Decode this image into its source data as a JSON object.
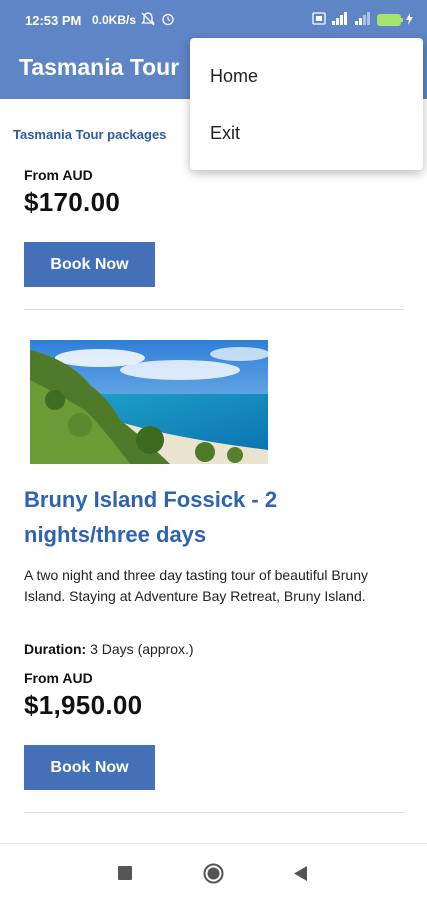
{
  "status_bar": {
    "time": "12:53 PM",
    "speed": "0.0KB/s",
    "battery": "100"
  },
  "app_bar": {
    "title": "Tasmania Tour"
  },
  "breadcrumb": "Tasmania Tour packages",
  "menu": {
    "items": [
      {
        "label": "Home"
      },
      {
        "label": "Exit"
      }
    ]
  },
  "tours": [
    {
      "from_label": "From AUD",
      "price": "$170.00",
      "book_label": "Book Now"
    },
    {
      "title": "Bruny Island Fossick - 2 nights/three days",
      "description": "A two night and three day tasting tour of beautiful Bruny Island. Staying at Adventure Bay Retreat, Bruny Island.",
      "duration_label": "Duration:",
      "duration_value": "3 Days (approx.)",
      "from_label": "From AUD",
      "price": "$1,950.00",
      "book_label": "Book Now"
    }
  ],
  "colors": {
    "header": "#5e85c6",
    "accent": "#4470b7",
    "title_blue": "#2f62b0"
  }
}
